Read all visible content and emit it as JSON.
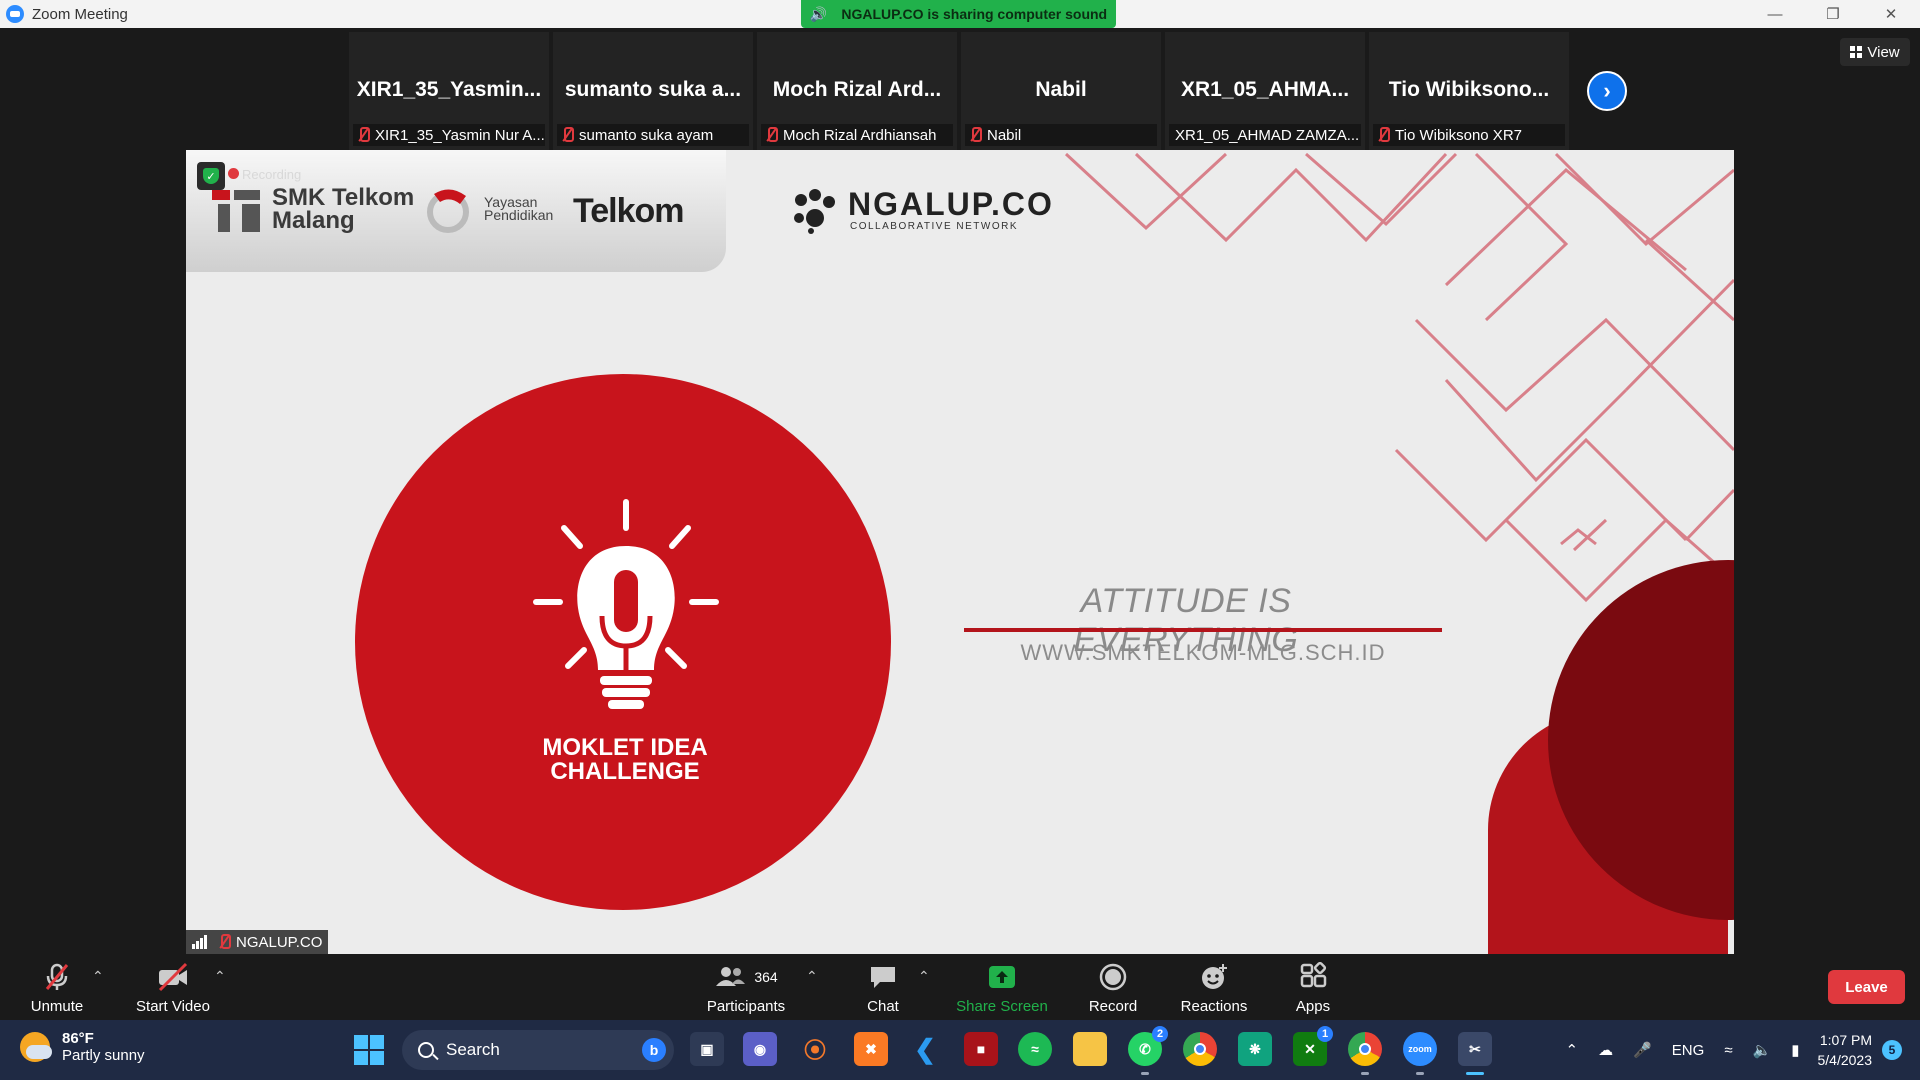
{
  "window": {
    "title": "Zoom Meeting",
    "controls": [
      "—",
      "❐",
      "✕"
    ]
  },
  "share_banner": {
    "text": "NGALUP.CO is sharing computer sound"
  },
  "participants_strip": {
    "tiles": [
      {
        "display_name": "XIR1_35_Yasmin...",
        "label": "XIR1_35_Yasmin Nur A...",
        "muted": true
      },
      {
        "display_name": "sumanto suka a...",
        "label": "sumanto suka ayam",
        "muted": true
      },
      {
        "display_name": "Moch Rizal Ard...",
        "label": "Moch Rizal Ardhiansah",
        "muted": true
      },
      {
        "display_name": "Nabil",
        "label": "Nabil",
        "muted": true
      },
      {
        "display_name": "XR1_05_AHMA...",
        "label": "XR1_05_AHMAD ZAMZA...",
        "muted": false
      },
      {
        "display_name": "Tio Wibiksono...",
        "label": "Tio Wibiksono XR7",
        "muted": true
      }
    ],
    "next_icon": "chevron-right-icon",
    "view_label": "View"
  },
  "shared_content": {
    "recording_label": "Recording",
    "smk_logo_text": "SMK Telkom\nMalang",
    "yayasan_text": "Yayasan\nPendidikan",
    "telkom_text": "Telkom",
    "ngalup_text": "NGALUP.CO",
    "ngalup_subtext": "COLLABORATIVE NETWORK",
    "challenge_text": "MOKLET IDEA\nCHALLENGE",
    "attitude_text": "ATTITUDE IS EVERYTHING",
    "website_text": "WWW.SMKTELKOM-MLG.SCH.ID",
    "presenter_name": "NGALUP.CO",
    "colors": {
      "brand_red": "#c8141c",
      "dark_red": "#7a0a10",
      "maze_line": "#d8808a"
    }
  },
  "controls": {
    "unmute_label": "Unmute",
    "start_video_label": "Start Video",
    "participants_label": "Participants",
    "participants_count": "364",
    "chat_label": "Chat",
    "share_screen_label": "Share Screen",
    "record_label": "Record",
    "reactions_label": "Reactions",
    "apps_label": "Apps",
    "leave_label": "Leave",
    "colors": {
      "share_green": "#21b14b",
      "leave_red": "#e0393e"
    }
  },
  "taskbar": {
    "weather_temp": "86°F",
    "weather_desc": "Partly sunny",
    "search_label": "Search",
    "apps": [
      {
        "name": "task-view-icon",
        "badge": ""
      },
      {
        "name": "teams-icon",
        "badge": ""
      },
      {
        "name": "blender-icon",
        "badge": ""
      },
      {
        "name": "xampp-icon",
        "badge": ""
      },
      {
        "name": "vscode-icon",
        "badge": ""
      },
      {
        "name": "game-icon",
        "badge": ""
      },
      {
        "name": "spotify-icon",
        "badge": ""
      },
      {
        "name": "file-explorer-icon",
        "badge": ""
      },
      {
        "name": "whatsapp-icon",
        "badge": "2"
      },
      {
        "name": "chrome-icon",
        "badge": ""
      },
      {
        "name": "chatgpt-icon",
        "badge": ""
      },
      {
        "name": "xbox-icon",
        "badge": "1"
      },
      {
        "name": "chrome-profile-icon",
        "badge": ""
      },
      {
        "name": "zoom-icon",
        "badge": ""
      },
      {
        "name": "snipping-tool-icon",
        "badge": ""
      }
    ],
    "language": "ENG",
    "time": "1:07 PM",
    "date": "5/4/2023",
    "notification_count": "5"
  }
}
